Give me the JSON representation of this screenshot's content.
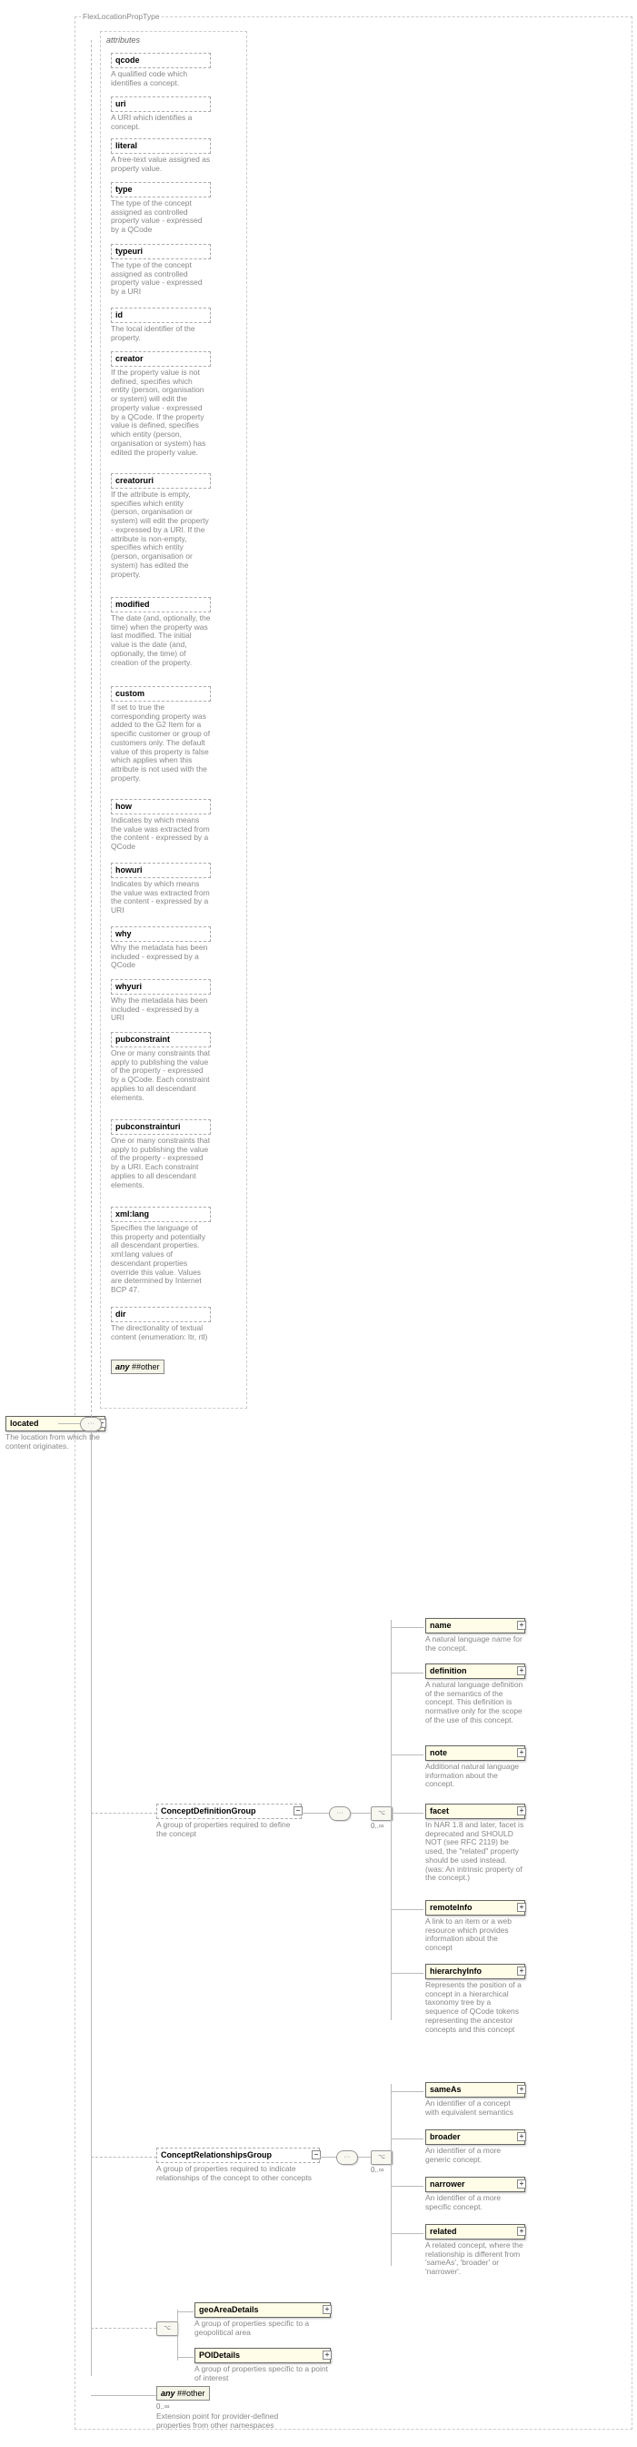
{
  "root": {
    "type_label": "FlexLocationPropType",
    "element": "located",
    "element_desc": "The location from which the content originates.",
    "attributes_label": "attributes"
  },
  "attributes": [
    {
      "name": "qcode",
      "desc": "A qualified code which identifies a concept."
    },
    {
      "name": "uri",
      "desc": "A URI which identifies a concept."
    },
    {
      "name": "literal",
      "desc": "A free-text value assigned as property value."
    },
    {
      "name": "type",
      "desc": "The type of the concept assigned as controlled property value - expressed by a QCode"
    },
    {
      "name": "typeuri",
      "desc": "The type of the concept assigned as controlled property value - expressed by a URI"
    },
    {
      "name": "id",
      "desc": "The local identifier of the property."
    },
    {
      "name": "creator",
      "desc": "If the property value is not defined, specifies which entity (person, organisation or system) will edit the property value - expressed by a QCode. If the property value is defined, specifies which entity (person, organisation or system) has edited the property value."
    },
    {
      "name": "creatoruri",
      "desc": "If the attribute is empty, specifies which entity (person, organisation or system) will edit the property - expressed by a URI. If the attribute is non-empty, specifies which entity (person, organisation or system) has edited the property."
    },
    {
      "name": "modified",
      "desc": "The date (and, optionally, the time) when the property was last modified. The initial value is the date (and, optionally, the time) of creation of the property."
    },
    {
      "name": "custom",
      "desc": "If set to true the corresponding property was added to the G2 Item for a specific customer or group of customers only. The default value of this property is false which applies when this attribute is not used with the property."
    },
    {
      "name": "how",
      "desc": "Indicates by which means the value was extracted from the content - expressed by a QCode"
    },
    {
      "name": "howuri",
      "desc": "Indicates by which means the value was extracted from the content - expressed by a URI"
    },
    {
      "name": "why",
      "desc": "Why the metadata has been included - expressed by a QCode"
    },
    {
      "name": "whyuri",
      "desc": "Why the metadata has been included - expressed by a URI"
    },
    {
      "name": "pubconstraint",
      "desc": "One or many constraints that apply to publishing the value of the property - expressed by a QCode. Each constraint applies to all descendant elements."
    },
    {
      "name": "pubconstrainturi",
      "desc": "One or many constraints that apply to publishing the value of the property - expressed by a URI. Each constraint applies to all descendant elements."
    },
    {
      "name": "xml:lang",
      "desc": "Specifies the language of this property and potentially all descendant properties. xml:lang values of descendant properties override this value. Values are determined by Internet BCP 47."
    },
    {
      "name": "dir",
      "desc": "The directionality of textual content (enumeration: ltr, rtl)"
    }
  ],
  "any_other_attr": "##other",
  "any_keyword": "any",
  "groups": {
    "def": {
      "name": "ConceptDefinitionGroup",
      "desc": "A group of properties required to define the concept",
      "card": "0..∞",
      "children": [
        {
          "name": "name",
          "desc": "A natural language name for the concept."
        },
        {
          "name": "definition",
          "desc": "A natural language definition of the semantics of the concept. This definition is normative only for the scope of the use of this concept."
        },
        {
          "name": "note",
          "desc": "Additional natural language information about the concept."
        },
        {
          "name": "facet",
          "desc": "In NAR 1.8 and later, facet is deprecated and SHOULD NOT (see RFC 2119) be used, the \"related\" property should be used instead. (was: An intrinsic property of the concept.)"
        },
        {
          "name": "remoteInfo",
          "desc": "A link to an item or a web resource which provides information about the concept"
        },
        {
          "name": "hierarchyInfo",
          "desc": "Represents the position of a concept in a hierarchical taxonomy tree by a sequence of QCode tokens representing the ancestor concepts and this concept"
        }
      ]
    },
    "rel": {
      "name": "ConceptRelationshipsGroup",
      "desc": "A group of properties required to indicate relationships of the concept to other concepts",
      "card": "0..∞",
      "children": [
        {
          "name": "sameAs",
          "desc": "An identifier of a concept with equivalent semantics"
        },
        {
          "name": "broader",
          "desc": "An identifier of a more generic concept."
        },
        {
          "name": "narrower",
          "desc": "An identifier of a more specific concept."
        },
        {
          "name": "related",
          "desc": "A related concept, where the relationship is different from 'sameAs', 'broader' or 'narrower'."
        }
      ]
    },
    "choice": [
      {
        "name": "geoAreaDetails",
        "desc": "A group of properties specific to a geopolitical area"
      },
      {
        "name": "POIDetails",
        "desc": "A group of properties specific to a point of interest"
      }
    ]
  },
  "ext_any": {
    "label": "##other",
    "card": "0..∞",
    "desc": "Extension point for provider-defined properties from other namespaces"
  },
  "chart_data": {
    "type": "diagram",
    "note": "XML schema structure diagram"
  }
}
